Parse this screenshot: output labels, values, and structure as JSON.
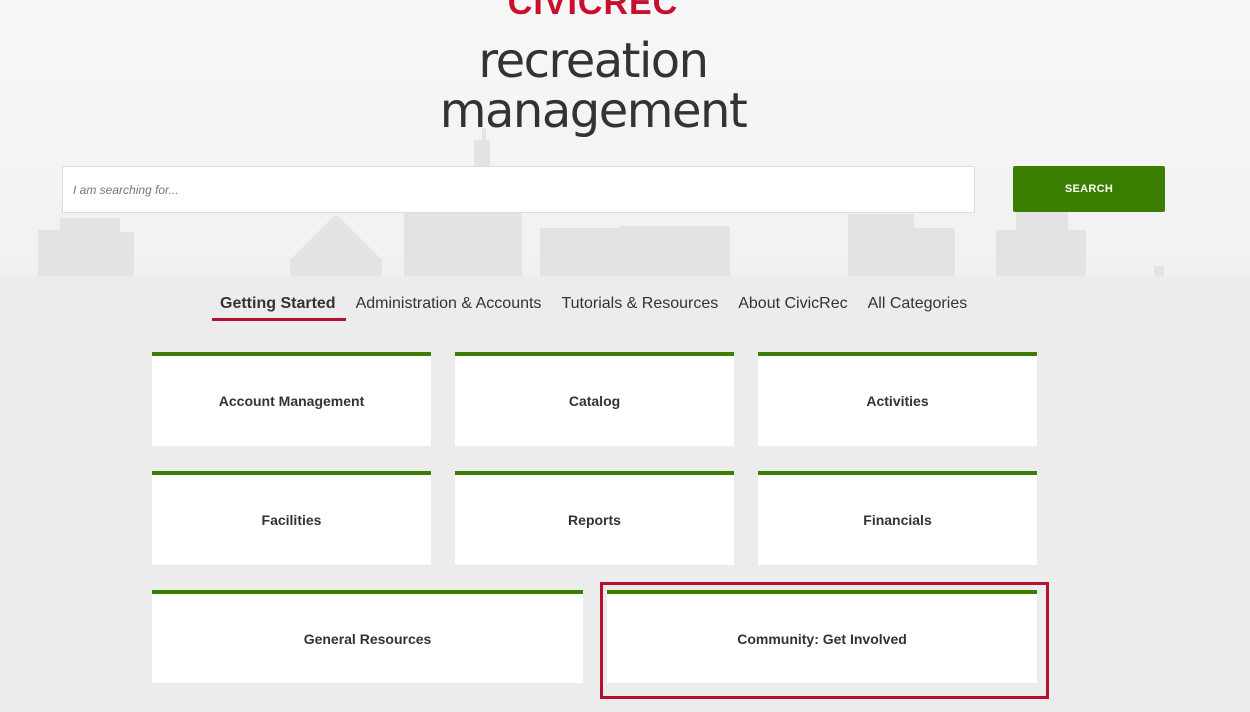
{
  "header": {
    "brand": "CIVICREC",
    "tagline_line1": "recreation",
    "tagline_line2": "management"
  },
  "search": {
    "placeholder": "I am searching for...",
    "value": "",
    "button_label": "SEARCH"
  },
  "tabs": [
    {
      "label": "Getting Started",
      "active": true
    },
    {
      "label": "Administration & Accounts",
      "active": false
    },
    {
      "label": "Tutorials & Resources",
      "active": false
    },
    {
      "label": "About CivicRec",
      "active": false
    },
    {
      "label": "All Categories",
      "active": false
    }
  ],
  "cards": [
    {
      "label": "Account Management"
    },
    {
      "label": "Catalog"
    },
    {
      "label": "Activities"
    },
    {
      "label": "Facilities"
    },
    {
      "label": "Reports"
    },
    {
      "label": "Financials"
    },
    {
      "label": "General Resources"
    },
    {
      "label": "Community: Get Involved",
      "highlighted": true
    }
  ],
  "colors": {
    "brand_red": "#c8102e",
    "accent_green": "#3a7d00",
    "tab_underline": "#b3122e",
    "highlight": "#b3122e",
    "background": "#ececec"
  }
}
